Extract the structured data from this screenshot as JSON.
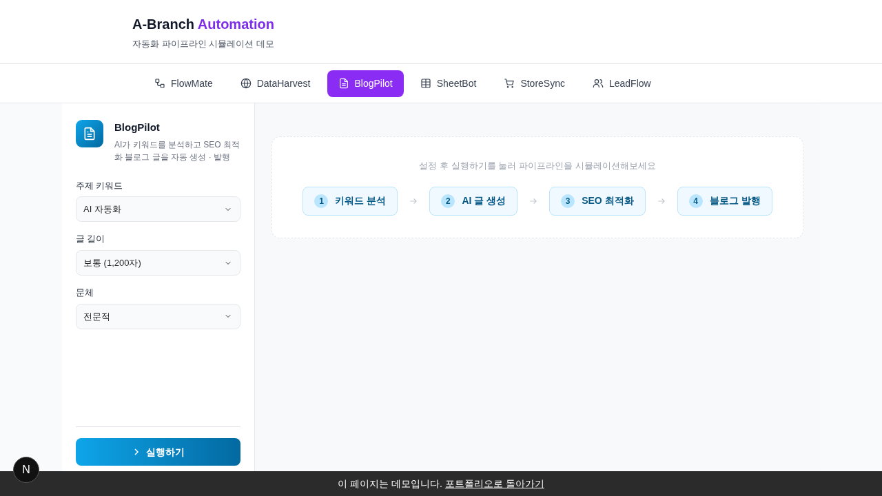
{
  "brand": {
    "title": "A-Branch",
    "accent": "Automation",
    "subtitle": "자동화 파이프라인 시뮬레이션 데모"
  },
  "tabs": [
    {
      "label": "FlowMate",
      "selected": false
    },
    {
      "label": "DataHarvest",
      "selected": false
    },
    {
      "label": "BlogPilot",
      "selected": true
    },
    {
      "label": "SheetBot",
      "selected": false
    },
    {
      "label": "StoreSync",
      "selected": false
    },
    {
      "label": "LeadFlow",
      "selected": false
    }
  ],
  "sidebar": {
    "title": "BlogPilot",
    "description": "AI가 키워드를 분석하고 SEO 최적화 블로그 글을 자동 생성 · 발행",
    "fields": [
      {
        "label": "주제 키워드",
        "value": "AI 자동화"
      },
      {
        "label": "글 길이",
        "value": "보통 (1,200자)"
      },
      {
        "label": "문체",
        "value": "전문적"
      }
    ],
    "run_button": "실행하기"
  },
  "pipeline": {
    "hint": "설정 후 실행하기를 눌러 파이프라인을 시뮬레이션해보세요",
    "steps": [
      {
        "number": "1",
        "label": "키워드 분석"
      },
      {
        "number": "2",
        "label": "AI 글 생성"
      },
      {
        "number": "3",
        "label": "SEO 최적화"
      },
      {
        "number": "4",
        "label": "블로그 발행"
      }
    ]
  },
  "dev_badge": "N",
  "footer": {
    "text": "이 페이지는 데모입니다.",
    "link": "포트폴리오로 돌아가기"
  }
}
